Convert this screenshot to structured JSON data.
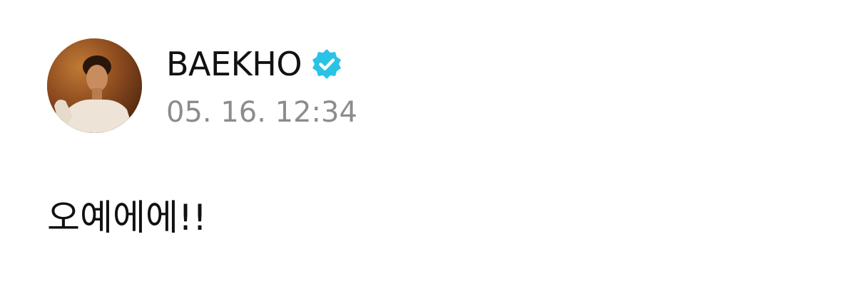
{
  "post": {
    "author": {
      "name": "BAEKHO",
      "verified": true,
      "verified_icon": "verified-badge-icon",
      "verified_color": "#29c3e6",
      "avatar_icon": "profile-photo"
    },
    "timestamp": "05. 16. 12:34",
    "body": "오예에에!!"
  }
}
